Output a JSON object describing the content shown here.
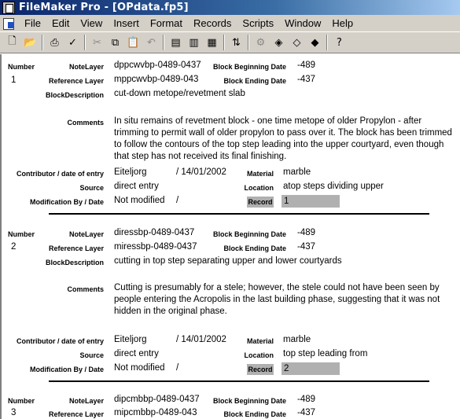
{
  "window": {
    "title": "FileMaker Pro - [OPdata.fp5]"
  },
  "menubar": {
    "items": [
      "File",
      "Edit",
      "View",
      "Insert",
      "Format",
      "Records",
      "Scripts",
      "Window",
      "Help"
    ]
  },
  "toolbar": {
    "buttons": [
      "new-document",
      "open",
      "print",
      "spelling",
      "cut",
      "copy",
      "paste",
      "undo",
      "sort",
      "find",
      "browse",
      "sort-records",
      "script",
      "script-alt",
      "show-all",
      "omit",
      "help"
    ]
  },
  "labels": {
    "number": "Number",
    "note_layer": "NoteLayer",
    "reference_layer": "Reference Layer",
    "block_beginning_date": "Block Beginning Date",
    "block_ending_date": "Block Ending Date",
    "block_description": "BlockDescription",
    "comments": "Comments",
    "contributor": "Contributor / date of entry",
    "source": "Source",
    "material": "Material",
    "location": "Location",
    "modification": "Modification By / Date",
    "record": "Record"
  },
  "records": [
    {
      "number": "1",
      "note_layer": "dppcwvbp-0489-0437",
      "reference_layer": "mppcwvbp-0489-043",
      "block_beginning_date": "-489",
      "block_ending_date": "-437",
      "block_description": "cut-down metope/revetment slab",
      "comments": "In situ remains of revetment block - one time metope of older Propylon - after trimming to permit wall of older propylon to pass over it.  The block has been trimmed to follow the contours of the top step leading into the upper courtyard, even though that step has not received its final finishing.",
      "contributor": "Eiteljorg",
      "entry_date": "/ 14/01/2002",
      "source": "direct entry",
      "material": "marble",
      "location": "atop steps dividing upper",
      "modification": "Not modified",
      "modification_sep": "/",
      "record": "1"
    },
    {
      "number": "2",
      "note_layer": "diressbp-0489-0437",
      "reference_layer": "miressbp-0489-0437",
      "block_beginning_date": "-489",
      "block_ending_date": "-437",
      "block_description": "cutting in top step separating upper and lower courtyards",
      "comments": "Cutting is presumably for a stele; however, the stele could not have been seen by people entering the Acropolis in the last building phase, suggesting that it was not hidden in the original phase.",
      "contributor": "Eiteljorg",
      "entry_date": "/ 14/01/2002",
      "source": "direct entry",
      "material": "marble",
      "location": "top step leading from",
      "modification": "Not modified",
      "modification_sep": "/",
      "record": "2"
    },
    {
      "number": "3",
      "note_layer": "dipcmbbp-0489-0437",
      "reference_layer": "mipcmbbp-0489-043",
      "block_beginning_date": "-489",
      "block_ending_date": "-437"
    }
  ]
}
